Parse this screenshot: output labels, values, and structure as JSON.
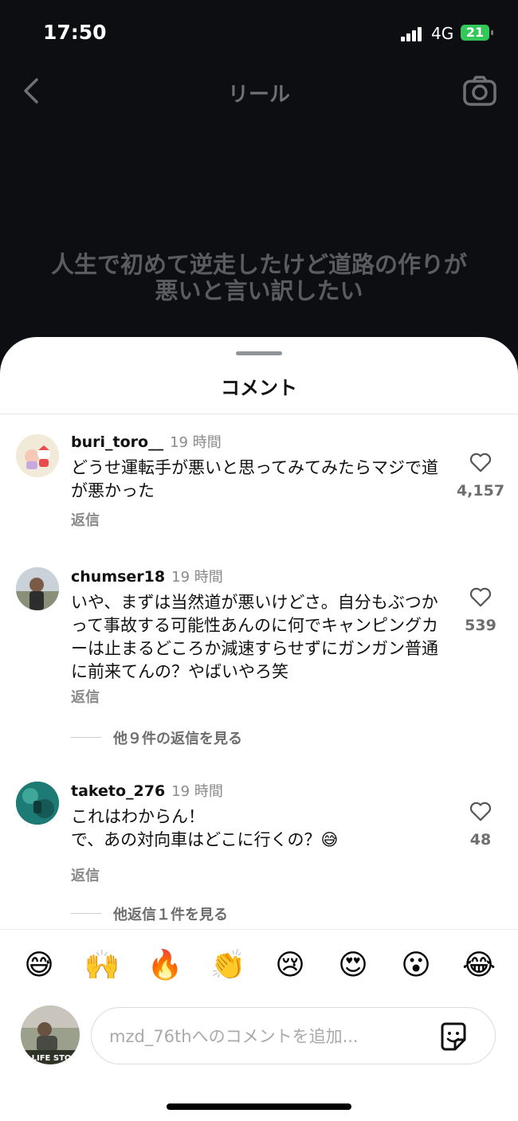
{
  "status_bar": {
    "time": "17:50",
    "network": "4G",
    "battery": "21"
  },
  "header": {
    "title": "リール",
    "back_icon": "chevron-left-icon",
    "camera_icon": "camera-icon"
  },
  "reel": {
    "caption": "人生で初めて逆走したけど道路の作りが悪いと言い訳したい"
  },
  "sheet": {
    "title": "コメント"
  },
  "comments": [
    {
      "username": "buri_toro__",
      "time": "19 時間",
      "text": "どうせ運転手が悪いと思ってみてみたらマジで道が悪かった",
      "reply_label": "返信",
      "likes": "4,157"
    },
    {
      "username": "chumser18",
      "time": "19 時間",
      "text": "いや、まずは当然道が悪いけどさ。自分もぶつかって事故する可能性あんのに何でキャンピングカーは止まるどころか減速すらせずにガンガン普通に前来てんの？やばいやろ笑",
      "reply_label": "返信",
      "likes": "539",
      "more_replies": "他９件の返信を見る"
    },
    {
      "username": "taketo_276",
      "time": "19 時間",
      "text_line1": "これはわからん！",
      "text_line2": "で、あの対向車はどこに行くの？😅",
      "reply_label": "返信",
      "likes": "48",
      "more_replies": "他返信１件を見る"
    }
  ],
  "emoji_bar": [
    "😅",
    "🙌",
    "🔥",
    "👏",
    "😢",
    "😍",
    "😮",
    "😂"
  ],
  "comment_input": {
    "placeholder": "mzd_76thへのコメントを追加...",
    "value": "",
    "avatar_text": "Y LIFE STOR"
  },
  "colors": {
    "accent_green": "#34c759",
    "dark_bg": "#0c0e12"
  }
}
